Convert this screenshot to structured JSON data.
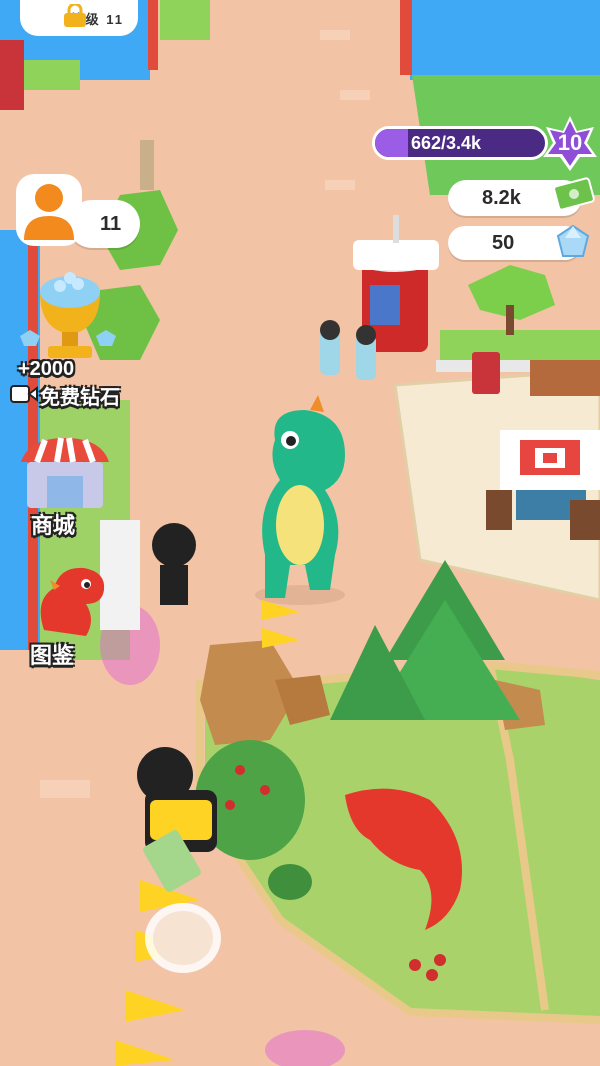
{
  "hud": {
    "xp": {
      "text": "662/3.4k",
      "progress": 0.195
    },
    "level": "10",
    "cash": "8.2k",
    "gems": "50",
    "visitors": "11",
    "locked_area_label": "等级 11"
  },
  "side_menu": {
    "free_gems_amount": "+2000",
    "free_gems_label": "免费钻石",
    "shop_label": "商城",
    "encyclopedia_label": "图鉴"
  },
  "colors": {
    "xp_track": "#4a2a83",
    "xp_fill": "#9b5de5",
    "level_star": "#8e4fd6",
    "ground": "#f2c3a5",
    "grass": "#8fd35a",
    "water": "#3fa9f5",
    "fence": "#e9c98a"
  },
  "icons": [
    "lock-icon",
    "level-star-icon",
    "cash-icon",
    "gem-icon",
    "visitor-icon",
    "trophy-icon",
    "video-icon",
    "shop-icon",
    "dino-icon"
  ]
}
